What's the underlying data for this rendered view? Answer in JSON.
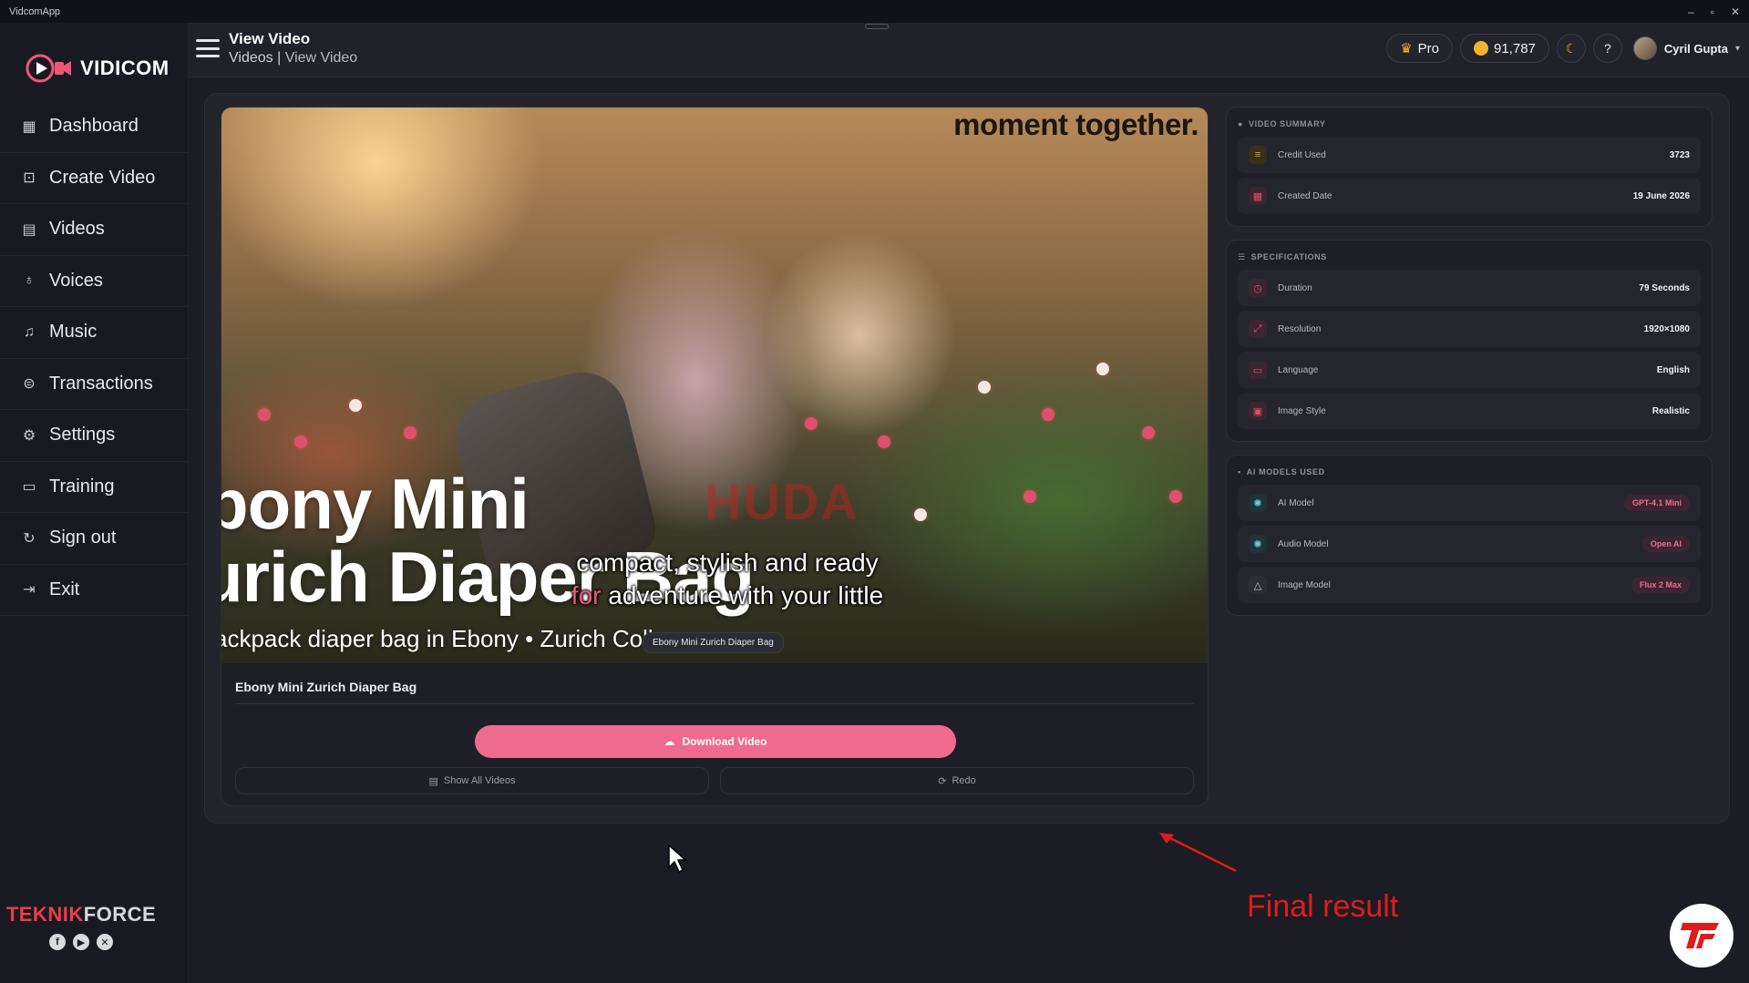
{
  "window": {
    "title": "VidcomApp",
    "controls": [
      "–",
      "▫",
      "✕"
    ]
  },
  "brand": {
    "name": "VIDICOM"
  },
  "sidebar": {
    "items": [
      {
        "label": "Dashboard",
        "icon": "dashboard-icon"
      },
      {
        "label": "Create Video",
        "icon": "create-video-icon"
      },
      {
        "label": "Videos",
        "icon": "videos-icon"
      },
      {
        "label": "Voices",
        "icon": "microphone-icon"
      },
      {
        "label": "Music",
        "icon": "music-icon"
      },
      {
        "label": "Transactions",
        "icon": "transactions-icon"
      },
      {
        "label": "Settings",
        "icon": "gear-icon"
      },
      {
        "label": "Training",
        "icon": "training-icon"
      },
      {
        "label": "Sign out",
        "icon": "sign-out-icon"
      },
      {
        "label": "Exit",
        "icon": "exit-icon"
      }
    ],
    "footer_brand_red": "TEKNIK",
    "footer_brand_white": "FORCE"
  },
  "header": {
    "title": "View Video",
    "breadcrumb_parent": "Videos",
    "breadcrumb_sep": " | ",
    "breadcrumb_current": "View Video",
    "plan_label": "Pro",
    "credits": "91,787",
    "user_name": "Cyril Gupta"
  },
  "video": {
    "overlay_top": "moment together.",
    "overlay_line1": "bony Mini",
    "overlay_line2": "urich Diaper Bag",
    "overlay_sub": "ackpack diaper bag in Ebony • Zurich Coll",
    "caption_line1": "compact, stylish and ready",
    "caption_for": "for",
    "caption_line2_rest": " adventure with your little",
    "tooltip": "Ebony Mini Zurich Diaper Bag",
    "title": "Ebony Mini Zurich Diaper Bag"
  },
  "actions": {
    "download_label": "Download Video",
    "show_all_label": "Show All Videos",
    "redo_label": "Redo"
  },
  "summary": {
    "heading": "VIDEO SUMMARY",
    "rows": [
      {
        "label": "Credit Used",
        "value": "3723",
        "icon": "credit-icon",
        "color": "#f0a030"
      },
      {
        "label": "Created Date",
        "value": "19 June 2026",
        "icon": "calendar-icon",
        "color": "#e0506a"
      }
    ]
  },
  "specifications": {
    "heading": "SPECIFICATIONS",
    "rows": [
      {
        "label": "Duration",
        "value": "79 Seconds",
        "icon": "clock-icon",
        "color": "#e0506a"
      },
      {
        "label": "Resolution",
        "value": "1920×1080",
        "icon": "resize-icon",
        "color": "#e0506a"
      },
      {
        "label": "Language",
        "value": "English",
        "icon": "language-icon",
        "color": "#e0506a"
      },
      {
        "label": "Image Style",
        "value": "Realistic",
        "icon": "image-icon",
        "color": "#e0506a"
      }
    ]
  },
  "ai_models": {
    "heading": "AI MODELS USED",
    "rows": [
      {
        "label": "AI Model",
        "value": "GPT-4.1 Mini",
        "icon": "openai-icon"
      },
      {
        "label": "Audio Model",
        "value": "Open AI",
        "icon": "openai-icon"
      },
      {
        "label": "Image Model",
        "value": "Flux 2 Max",
        "icon": "triangle-icon"
      }
    ]
  },
  "annotation": {
    "label": "Final result"
  },
  "colors": {
    "accent": "#ef6a8f",
    "background": "#1b1c24",
    "annotation": "#e01b1b"
  }
}
